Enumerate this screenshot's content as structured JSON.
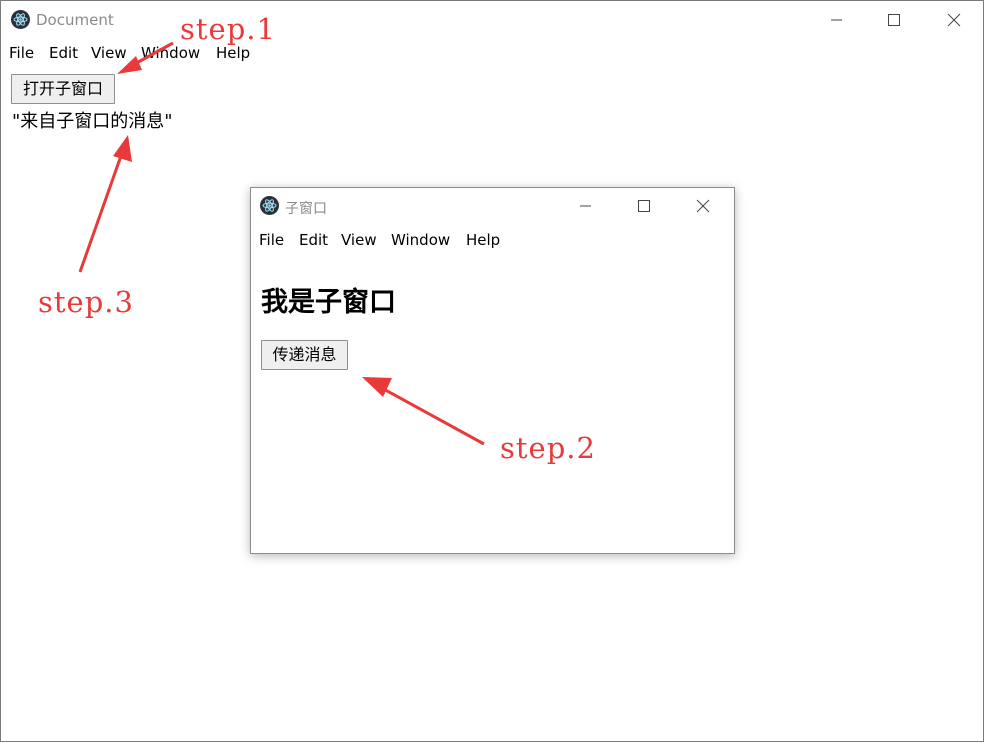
{
  "main_window": {
    "title": "Document",
    "menu": [
      "File",
      "Edit",
      "View",
      "Window",
      "Help"
    ],
    "open_button_label": "打开子窗口",
    "message_text": "\"来自子窗口的消息\""
  },
  "child_window": {
    "title": "子窗口",
    "menu": [
      "File",
      "Edit",
      "View",
      "Window",
      "Help"
    ],
    "heading": "我是子窗口",
    "send_button_label": "传递消息"
  },
  "annotations": {
    "step1": "step.1",
    "step2": "step.2",
    "step3": "step.3",
    "color": "#e83a3a"
  },
  "icons": {
    "app": "electron-icon",
    "minimize": "minimize-icon",
    "maximize": "maximize-icon",
    "close": "close-icon"
  }
}
